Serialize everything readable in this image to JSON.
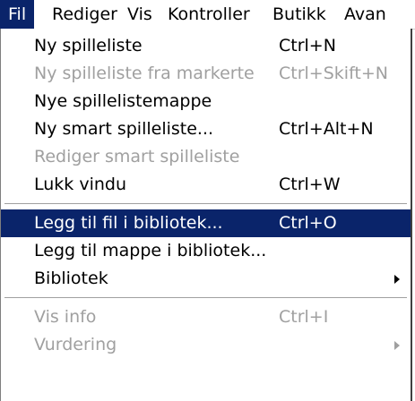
{
  "menubar": {
    "items": [
      {
        "label": "Fil"
      },
      {
        "label": "Rediger"
      },
      {
        "label": "Vis"
      },
      {
        "label": "Kontroller"
      },
      {
        "label": "Butikk"
      },
      {
        "label": "Avan"
      }
    ],
    "active_index": 0
  },
  "colors": {
    "highlight": "#0a246a",
    "disabled_text": "#a0a0a0"
  },
  "file_menu": {
    "items": [
      {
        "label": "Ny spilleliste",
        "shortcut": "Ctrl+N",
        "enabled": true
      },
      {
        "label": "Ny spilleliste fra markerte",
        "shortcut": "Ctrl+Skift+N",
        "enabled": false
      },
      {
        "label": "Nye spillelistemappe",
        "shortcut": "",
        "enabled": true
      },
      {
        "label": "Ny smart spilleliste...",
        "shortcut": "Ctrl+Alt+N",
        "enabled": true
      },
      {
        "label": "Rediger smart spilleliste",
        "shortcut": "",
        "enabled": false
      },
      {
        "label": "Lukk vindu",
        "shortcut": "Ctrl+W",
        "enabled": true
      },
      {
        "label": "Legg til fil i bibliotek...",
        "shortcut": "Ctrl+O",
        "enabled": true,
        "highlighted": true
      },
      {
        "label": "Legg til mappe i bibliotek...",
        "shortcut": "",
        "enabled": true
      },
      {
        "label": "Bibliotek",
        "shortcut": "",
        "enabled": true,
        "submenu": true
      },
      {
        "label": "Vis info",
        "shortcut": "Ctrl+I",
        "enabled": false
      },
      {
        "label": "Vurdering",
        "shortcut": "",
        "enabled": false,
        "submenu": true
      }
    ]
  }
}
